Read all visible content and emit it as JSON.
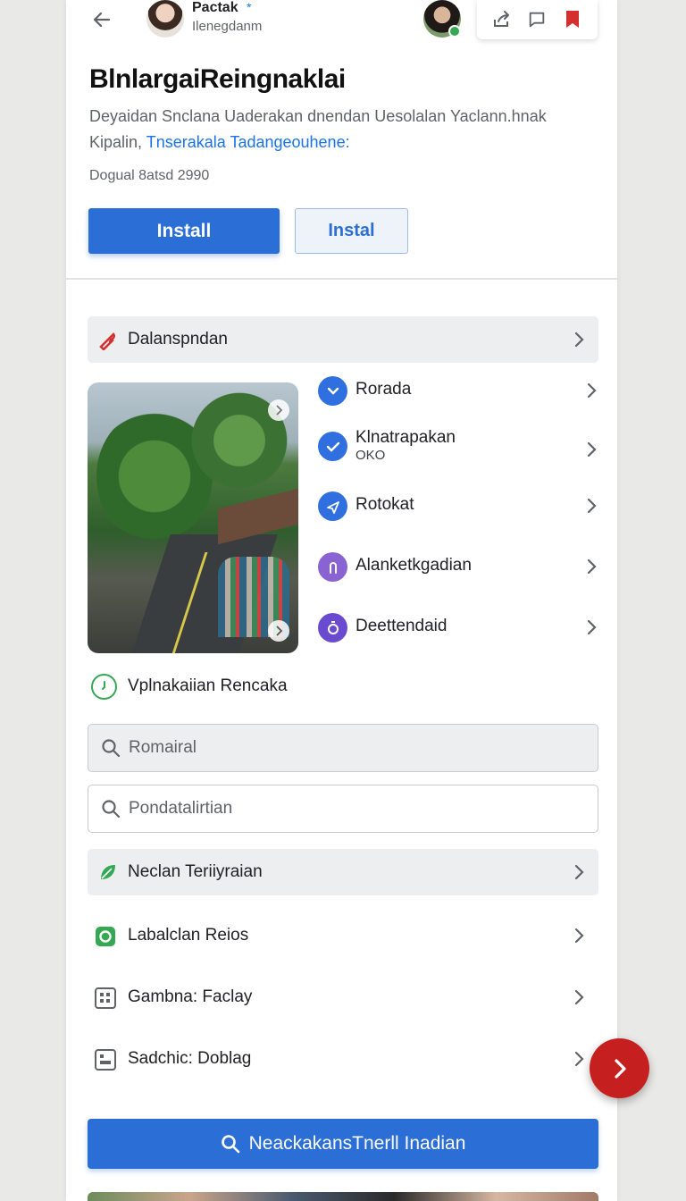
{
  "header": {
    "name": "Pactak",
    "star": "*",
    "subtitle": "Ilenegdanm"
  },
  "title": "BlnlargaiReingnaklai",
  "description": {
    "text": "Deyaidan Snclana Uaderakan dnendan Uesolalan Yaclann.hnak Kipalin,",
    "link": "Tnserakala Tadangeouhene:"
  },
  "meta": "Dogual  8atsd 2990",
  "buttons": {
    "primary": "Install",
    "secondary": "Instal"
  },
  "section_row": {
    "label": "Dalanspndan"
  },
  "list": [
    {
      "label": "Rorada",
      "sub": ""
    },
    {
      "label": "Klnatrapakan",
      "sub": "OKO"
    },
    {
      "label": "Rotokat",
      "sub": ""
    },
    {
      "label": "Alanketkgadian",
      "sub": ""
    },
    {
      "label": "Deettendaid",
      "sub": ""
    }
  ],
  "status": {
    "label": "Vplnakaiian Rencaka"
  },
  "search1": {
    "placeholder": "Romairal"
  },
  "search2": {
    "placeholder": "Pondatalirtian"
  },
  "section_row2": {
    "label": "Neclan Teriiyraian"
  },
  "rows": [
    {
      "label": "Labalclan Reios"
    },
    {
      "label": "Gambna: Faclay"
    },
    {
      "label": "Sadchic: Doblag"
    }
  ],
  "bottom_button": {
    "label": "NeackakansTnerll Inadian"
  },
  "icons": {
    "back": "arrow-left-icon",
    "share": "share-icon",
    "chat": "chat-icon",
    "bookmark": "bookmark-icon",
    "tag": "tag-icon",
    "leaf": "leaf-icon",
    "gear": "gear-icon",
    "grid": "grid-icon",
    "search": "search-icon",
    "fab": "chevron-right-icon"
  },
  "colors": {
    "primary": "#2b6fd6",
    "link": "#1a73e8",
    "fab": "#c51f1f",
    "green": "#34a853",
    "purple": "#7c5cd6"
  }
}
